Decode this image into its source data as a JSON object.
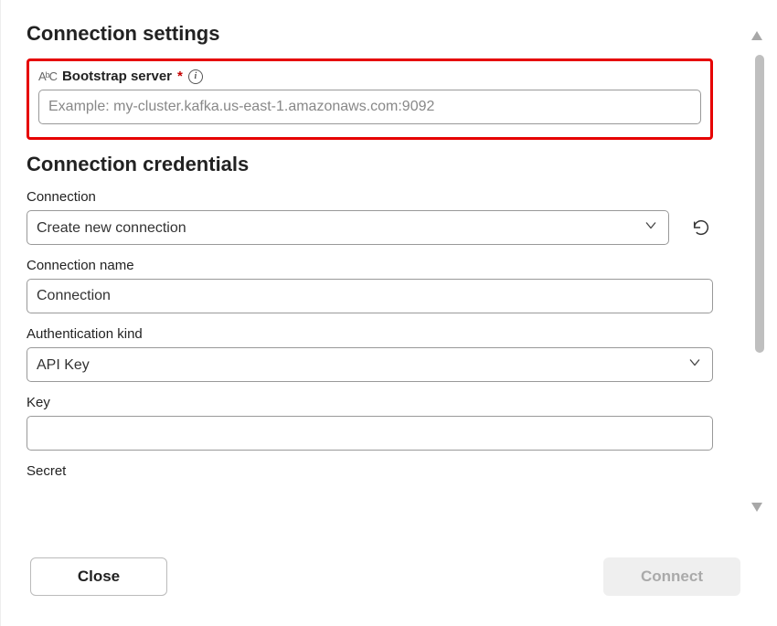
{
  "sections": {
    "settings_title": "Connection settings",
    "credentials_title": "Connection credentials"
  },
  "bootstrap": {
    "icon_text": "AᵇC",
    "label": "Bootstrap server",
    "required_mark": "*",
    "info_glyph": "i",
    "placeholder": "Example: my-cluster.kafka.us-east-1.amazonaws.com:9092",
    "value": ""
  },
  "connection": {
    "label": "Connection",
    "selected": "Create new connection"
  },
  "connection_name": {
    "label": "Connection name",
    "value": "Connection"
  },
  "auth_kind": {
    "label": "Authentication kind",
    "selected": "API Key"
  },
  "key": {
    "label": "Key",
    "value": ""
  },
  "secret": {
    "label": "Secret",
    "value": ""
  },
  "footer": {
    "close": "Close",
    "connect": "Connect"
  }
}
